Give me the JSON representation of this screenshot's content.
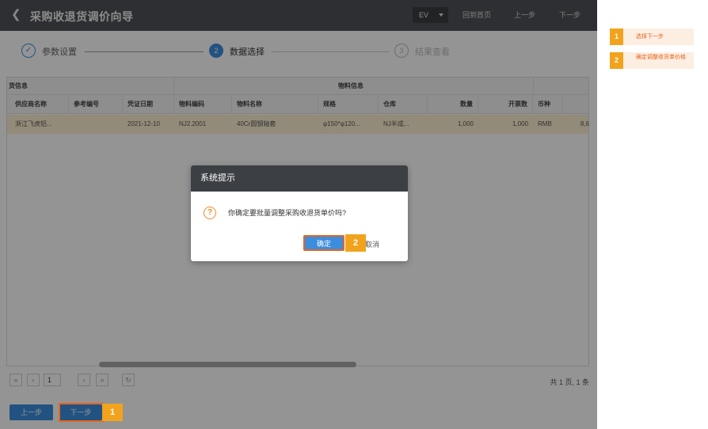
{
  "titlebar": {
    "title": "采购收退货调价向导",
    "env": "EV",
    "home": "回到首页",
    "prev": "上一步",
    "next": "下一步"
  },
  "steps": [
    {
      "index": "✓",
      "label": "参数设置",
      "state": "done"
    },
    {
      "index": "2",
      "label": "数据选择",
      "state": "active"
    },
    {
      "index": "3",
      "label": "结果查看",
      "state": "todo"
    }
  ],
  "table": {
    "group_left": "货信息",
    "group_material": "物料信息",
    "columns": [
      "供应商名称",
      "参考编号",
      "凭证日期",
      "物料编码",
      "物料名称",
      "规格",
      "仓库",
      "数量",
      "开票数",
      "币种"
    ],
    "rows": [
      {
        "supplier": "浙江飞虎铝...",
        "ref": "",
        "date": "2021-12-10",
        "code": "NJ2.2001",
        "name": "40Cr圆钢轴套",
        "spec": "φ150*φ120...",
        "warehouse": "NJ半成...",
        "qty": "1,000",
        "invoiced": "1,000",
        "currency": "RMB",
        "extra": "8,6"
      }
    ]
  },
  "pager": {
    "first": "«",
    "prev": "‹",
    "page": "1",
    "next": "›",
    "last": "»",
    "refresh": "↻",
    "info": "共 1 页, 1 条"
  },
  "bottom": {
    "prev": "上一步",
    "next": "下一步"
  },
  "dialog": {
    "title": "系统提示",
    "icon": "?",
    "message": "你确定要批量调整采购收退货单价吗?",
    "ok": "确定",
    "cancel": "取消"
  },
  "markers": {
    "one": "1",
    "two": "2"
  },
  "annotations": [
    {
      "num": "1",
      "text": "选择下一步"
    },
    {
      "num": "2",
      "text": "确定调整收货单价格"
    }
  ],
  "colors": {
    "accent": "#3c8dde",
    "marker": "#f2a31d",
    "highlight": "#e5651f",
    "row_selected": "#fdf0d0"
  }
}
